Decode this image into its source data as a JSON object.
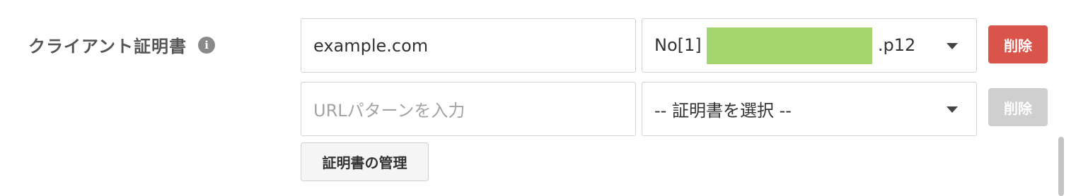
{
  "field": {
    "label": "クライアント証明書",
    "info_icon": "info-icon"
  },
  "rows": [
    {
      "url_value": "example.com",
      "url_placeholder": "",
      "cert_prefix": "No[1]",
      "cert_suffix": ".p12",
      "delete_label": "削除",
      "delete_enabled": true
    },
    {
      "url_value": "",
      "url_placeholder": "URLパターンを入力",
      "cert_selected": "-- 証明書を選択 --",
      "delete_label": "削除",
      "delete_enabled": false
    }
  ],
  "manage_button_label": "証明書の管理",
  "colors": {
    "danger": "#d9544a",
    "disabled": "#cfcfcf",
    "redaction": "#a3d46e"
  }
}
